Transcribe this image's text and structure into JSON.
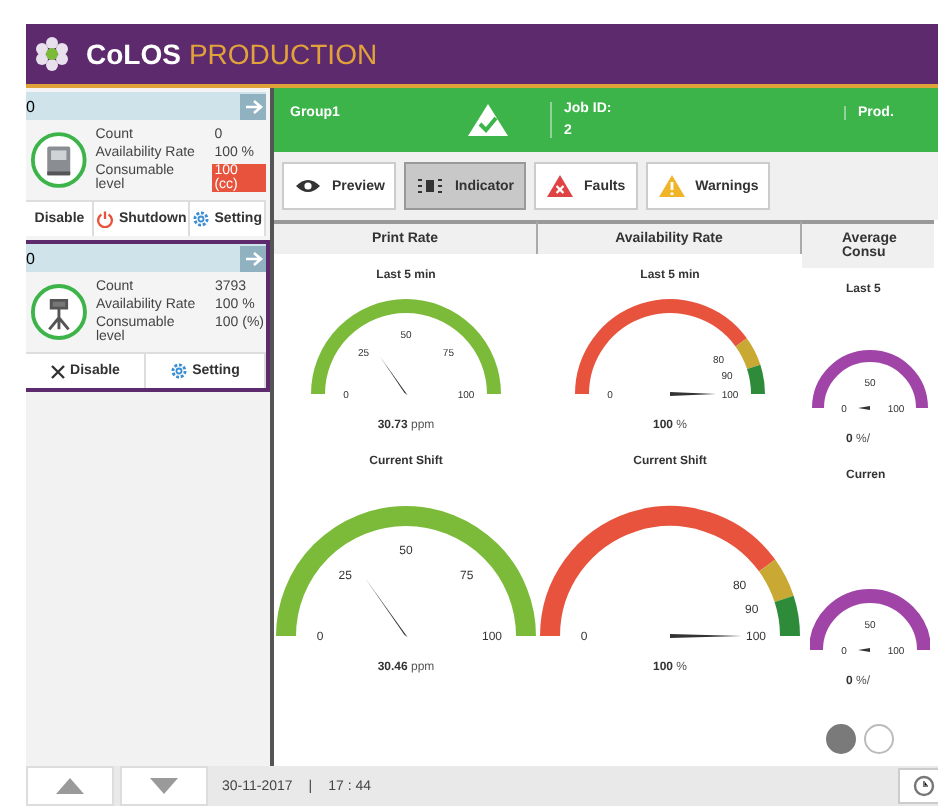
{
  "header": {
    "brand": "CoLOS",
    "product": "PRODUCTION"
  },
  "devices": [
    {
      "name": "0",
      "selected": false,
      "kind": "printer",
      "stats": [
        {
          "label": "Count",
          "value": "0",
          "alert": false
        },
        {
          "label": "Availability Rate",
          "value": "100 %",
          "alert": false
        },
        {
          "label": "Consumable level",
          "value": "100 (cc)",
          "alert": true
        }
      ],
      "actions": [
        {
          "kind": "disable",
          "label": "Disable"
        },
        {
          "kind": "shutdown",
          "label": "Shutdown"
        },
        {
          "kind": "setting",
          "label": "Setting"
        }
      ]
    },
    {
      "name": "0",
      "selected": true,
      "kind": "labeler",
      "stats": [
        {
          "label": "Count",
          "value": "3793",
          "alert": false
        },
        {
          "label": "Availability Rate",
          "value": "100 %",
          "alert": false
        },
        {
          "label": "Consumable level",
          "value": "100 (%)",
          "alert": false
        }
      ],
      "actions": [
        {
          "kind": "disable",
          "label": "Disable"
        },
        {
          "kind": "setting",
          "label": "Setting"
        }
      ]
    }
  ],
  "status": {
    "group": "Group1",
    "job_label": "Job ID:",
    "job_value": "2",
    "prod": "Prod."
  },
  "views": [
    {
      "kind": "preview",
      "label": "Preview",
      "selected": false
    },
    {
      "kind": "indicator",
      "label": "Indicator",
      "selected": true
    },
    {
      "kind": "faults",
      "label": "Faults",
      "selected": false
    },
    {
      "kind": "warnings",
      "label": "Warnings",
      "selected": false
    }
  ],
  "columns": [
    {
      "heading": "Print Rate",
      "gauges": [
        {
          "title": "Last 5 min",
          "value": "30.73",
          "unit": "ppm",
          "bands": [
            {
              "color": "#7cbb3a"
            }
          ],
          "ticks": [
            "0",
            "25",
            "50",
            "75",
            "100"
          ]
        },
        {
          "title": "Current Shift",
          "value": "30.46",
          "unit": "ppm",
          "bands": [
            {
              "color": "#7cbb3a"
            }
          ],
          "ticks": [
            "0",
            "25",
            "50",
            "75",
            "100"
          ]
        }
      ]
    },
    {
      "heading": "Availability Rate",
      "gauges": [
        {
          "title": "Last 5 min",
          "value": "100",
          "unit": "%",
          "bands": [
            {
              "color": "#e8533d"
            },
            {
              "color": "#c9a833"
            },
            {
              "color": "#2e8b3a"
            }
          ],
          "ticks": [
            "0",
            "80",
            "90",
            "100"
          ]
        },
        {
          "title": "Current Shift",
          "value": "100",
          "unit": "%",
          "bands": [
            {
              "color": "#e8533d"
            },
            {
              "color": "#c9a833"
            },
            {
              "color": "#2e8b3a"
            }
          ],
          "ticks": [
            "0",
            "80",
            "90",
            "100"
          ]
        }
      ]
    },
    {
      "heading": "Average Consu",
      "gauges": [
        {
          "title": "Last 5",
          "value": "0",
          "unit": "%/",
          "bands": [
            {
              "color": "#a044a8"
            }
          ],
          "ticks": [
            "0",
            "50",
            "100"
          ]
        },
        {
          "title": "Curren",
          "value": "0",
          "unit": "%/",
          "bands": [
            {
              "color": "#a044a8"
            }
          ],
          "ticks": [
            "0",
            "50",
            "100"
          ]
        }
      ]
    }
  ],
  "pager": [
    {
      "selected": true
    },
    {
      "selected": false
    }
  ],
  "footer": {
    "date": "30-11-2017",
    "separator": "|",
    "time": "17 : 44"
  }
}
